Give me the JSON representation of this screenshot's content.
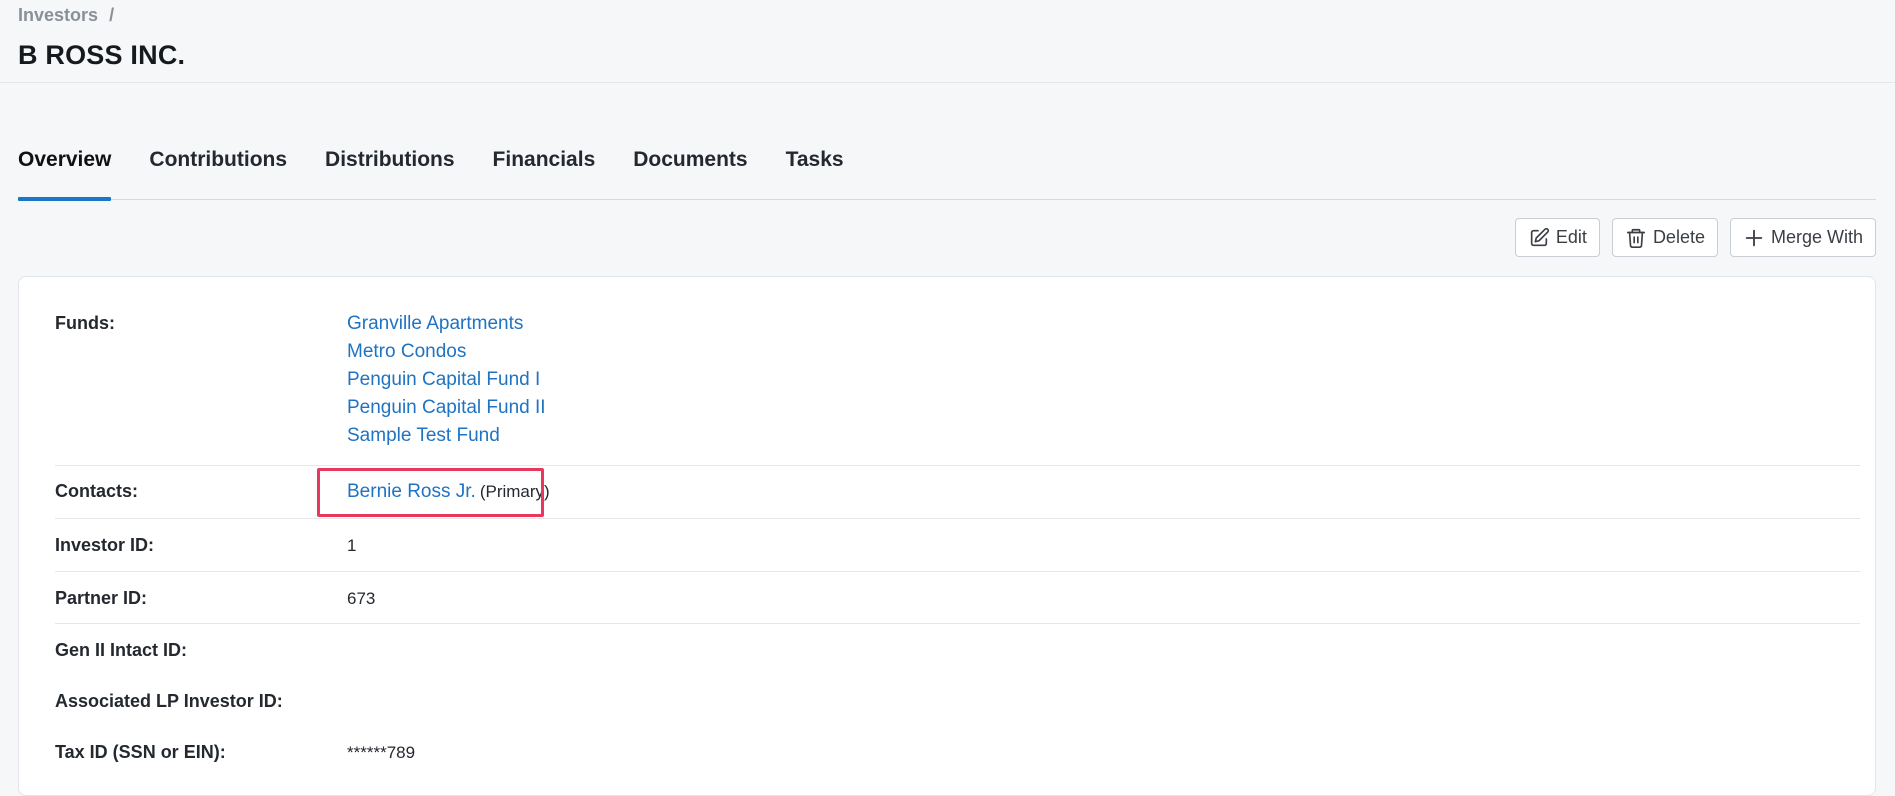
{
  "breadcrumb": {
    "parent": "Investors",
    "separator": "/"
  },
  "page": {
    "title": "B ROSS INC."
  },
  "tabs": [
    {
      "label": "Overview",
      "active": true
    },
    {
      "label": "Contributions"
    },
    {
      "label": "Distributions"
    },
    {
      "label": "Financials"
    },
    {
      "label": "Documents"
    },
    {
      "label": "Tasks"
    }
  ],
  "actions": {
    "edit": {
      "label": "Edit",
      "icon": "edit-icon"
    },
    "delete": {
      "label": "Delete",
      "icon": "trash-icon"
    },
    "merge": {
      "label": "Merge With",
      "icon": "plus-icon"
    }
  },
  "details": {
    "funds_label": "Funds:",
    "funds": [
      "Granville Apartments",
      "Metro Condos",
      "Penguin Capital Fund I",
      "Penguin Capital Fund II",
      "Sample Test Fund"
    ],
    "contacts_label": "Contacts:",
    "contact_name": "Bernie Ross Jr.",
    "contact_role": "(Primary)",
    "investor_id_label": "Investor ID:",
    "investor_id": "1",
    "partner_id_label": "Partner ID:",
    "partner_id": "673",
    "gen2_label": "Gen II Intact ID:",
    "gen2_value": "",
    "assoc_label": "Associated LP Investor ID:",
    "assoc_value": "",
    "tax_label": "Tax ID (SSN or EIN):",
    "tax_value": "******789"
  },
  "colors": {
    "link": "#1f73c2",
    "active_tab_underline": "#1a76c9",
    "highlight_box": "#e8385d"
  }
}
